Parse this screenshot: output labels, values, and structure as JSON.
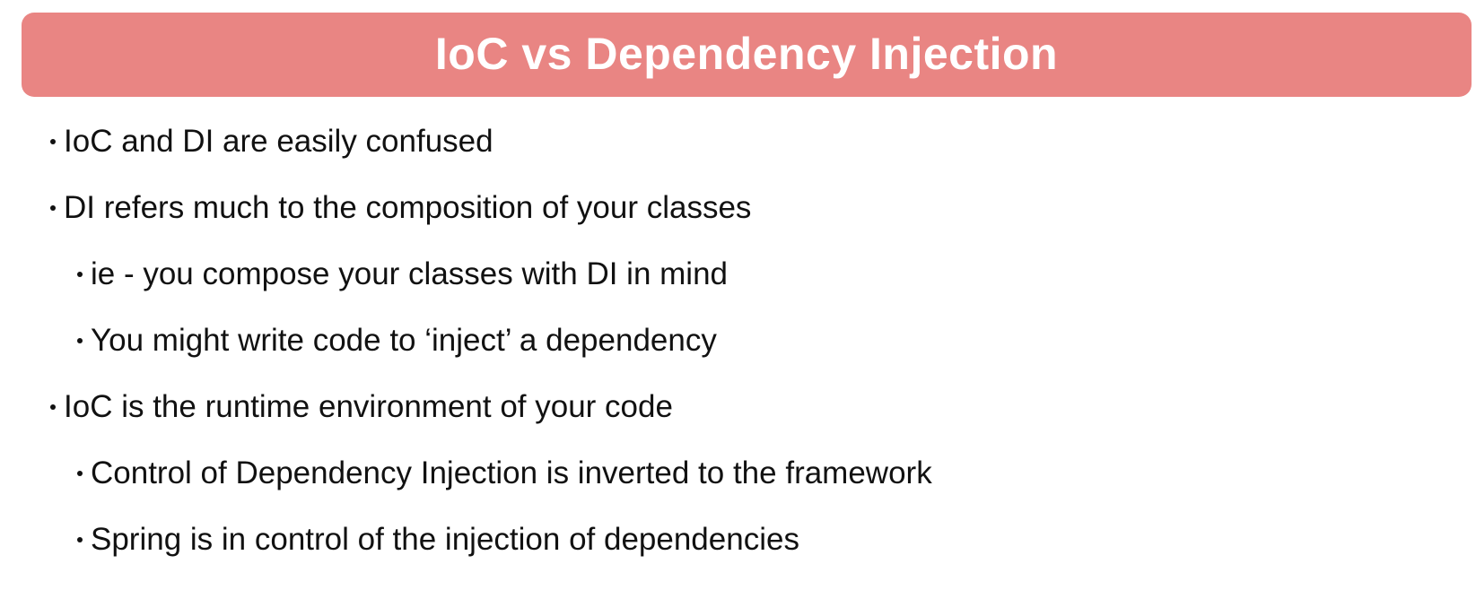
{
  "slide": {
    "title": "IoC vs Dependency Injection",
    "accent_color": "#e98583",
    "bullets": [
      {
        "level": 1,
        "text": "IoC and DI are easily confused"
      },
      {
        "level": 1,
        "text": "DI refers much to the composition of your classes"
      },
      {
        "level": 2,
        "text": "ie - you compose your classes with DI in mind"
      },
      {
        "level": 2,
        "text": "You might write code to ‘inject’ a dependency"
      },
      {
        "level": 1,
        "text": "IoC is the runtime environment of your code"
      },
      {
        "level": 2,
        "text": "Control of Dependency Injection is inverted to the framework"
      },
      {
        "level": 2,
        "text": "Spring is in control of the injection of dependencies"
      }
    ]
  }
}
